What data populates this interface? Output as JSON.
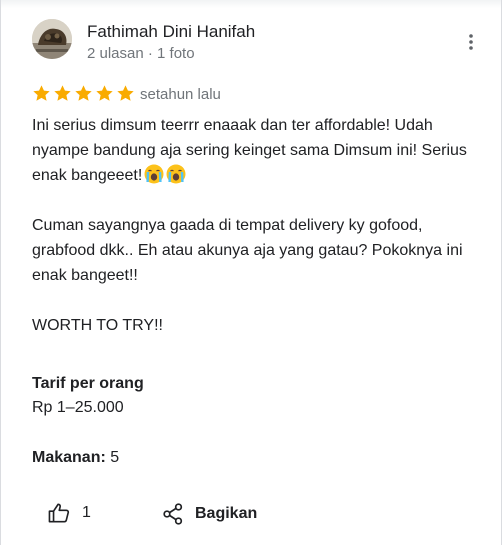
{
  "reviewer": {
    "name": "Fathimah Dini Hanifah",
    "meta": "2 ulasan · 1 foto",
    "avatar_icon": "profile-photo"
  },
  "menu": {
    "icon": "more-vert-icon"
  },
  "rating": {
    "stars": 5,
    "max": 5,
    "star_color": "#f9ab00",
    "time": "setahun lalu"
  },
  "review": {
    "paragraph1": "Ini serius dimsum teerrr enaaak dan ter affordable! Udah nyampe bandung aja sering keinget sama Dimsum ini! Serius enak bangeeet!",
    "emoji_icon": "loudly-crying-face",
    "paragraph2": "Cuman sayangnya gaada di tempat delivery ky gofood, grabfood dkk.. Eh atau akunya aja yang gatau? Pokoknya ini enak bangeet!!",
    "paragraph3": "WORTH TO TRY!!"
  },
  "details": {
    "price_label": "Tarif per orang",
    "price_value": "Rp 1–25.000",
    "food_label": "Makanan:",
    "food_value": "5"
  },
  "actions": {
    "like_count": "1",
    "share_label": "Bagikan"
  }
}
